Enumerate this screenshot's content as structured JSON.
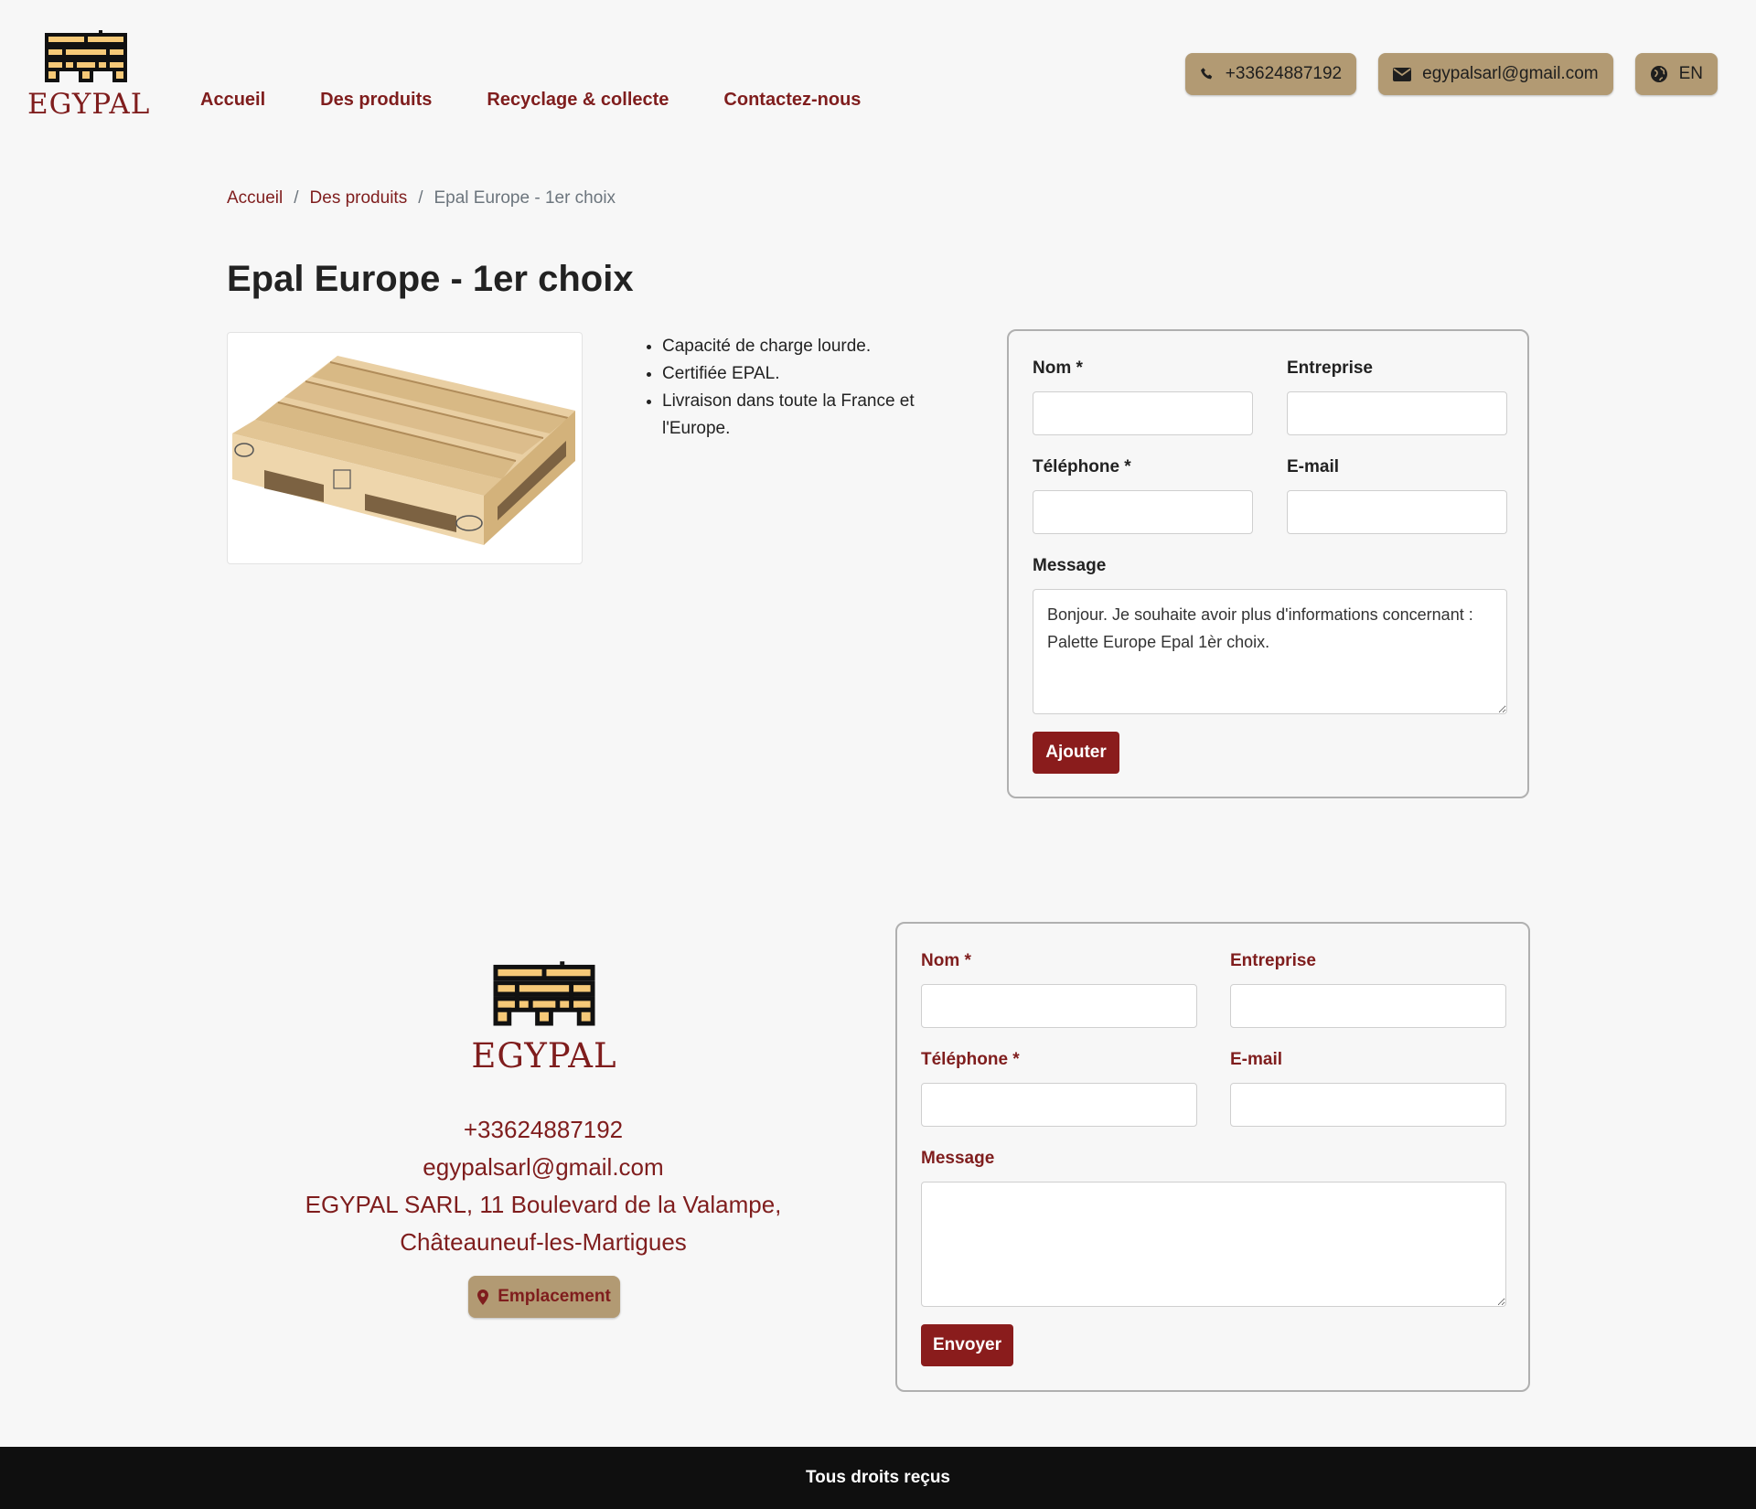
{
  "brand": {
    "name": "EGYPAL"
  },
  "nav": {
    "items": [
      {
        "label": "Accueil"
      },
      {
        "label": "Des produits"
      },
      {
        "label": "Recyclage & collecte"
      },
      {
        "label": "Contactez-nous"
      }
    ]
  },
  "topbar": {
    "phone": "+33624887192",
    "email": "egypalsarl@gmail.com",
    "language": "EN",
    "icons": {
      "phone": "phone-icon",
      "email": "envelope-icon",
      "language": "globe-icon"
    }
  },
  "breadcrumb": {
    "home": "Accueil",
    "separator": "/",
    "category": "Des produits",
    "current": "Epal Europe - 1er choix"
  },
  "product": {
    "title": "Epal Europe - 1er choix",
    "image_alt": "EUR EPAL wooden pallet",
    "features": [
      "Capacité de charge lourde.",
      "Certifiée EPAL.",
      "Livraison dans toute la France et l'Europe."
    ]
  },
  "product_form": {
    "name_label": "Nom *",
    "company_label": "Entreprise",
    "phone_label": "Téléphone *",
    "email_label": "E-mail",
    "message_label": "Message",
    "message_value": "Bonjour. Je souhaite avoir plus d'informations concernant : Palette Europe Epal 1èr choix.",
    "submit_label": "Ajouter"
  },
  "footer_contact": {
    "phone": "+33624887192",
    "email": "egypalsarl@gmail.com",
    "address_line1": "EGYPAL SARL, 11 Boulevard de la Valampe,",
    "address_line2": "Châteauneuf-les-Martigues",
    "location_button": "Emplacement",
    "location_icon": "map-marker-icon"
  },
  "footer_form": {
    "name_label": "Nom *",
    "company_label": "Entreprise",
    "phone_label": "Téléphone *",
    "email_label": "E-mail",
    "message_label": "Message",
    "message_value": "",
    "submit_label": "Envoyer"
  },
  "colors": {
    "accent": "#7f1d1d",
    "button": "#8a1c1c",
    "pill": "#b29a73",
    "background": "#f7f7f7",
    "footer_bar": "#0f0f0f"
  },
  "copyright": "Tous droits reçus"
}
